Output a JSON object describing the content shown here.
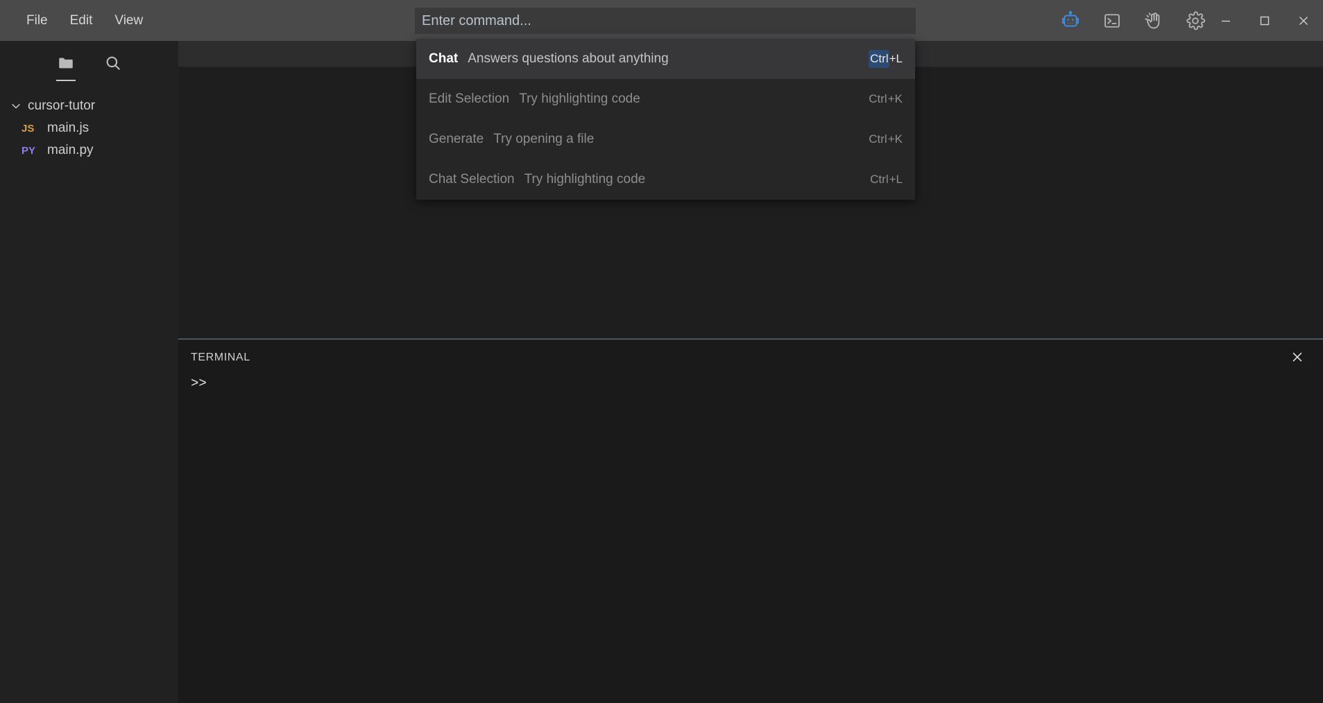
{
  "window": {
    "menu": [
      {
        "label": "File",
        "name": "menu-file"
      },
      {
        "label": "Edit",
        "name": "menu-edit"
      },
      {
        "label": "View",
        "name": "menu-view"
      }
    ],
    "controls": {
      "minimize": "–",
      "maximize": "□",
      "close": "✕"
    },
    "toolbar_icons": [
      {
        "name": "ai-robot-icon",
        "label": "AI Assistant",
        "color": "#3f8ae0"
      },
      {
        "name": "terminal-icon",
        "label": "Terminal",
        "color": "#b4b4b4"
      },
      {
        "name": "hand-wave-icon",
        "label": "Help",
        "color": "#b4b4b4"
      },
      {
        "name": "gear-icon",
        "label": "Settings",
        "color": "#b4b4b4"
      }
    ]
  },
  "command_bar": {
    "placeholder": "Enter command...",
    "value": ""
  },
  "command_palette": {
    "items": [
      {
        "title": "Chat",
        "description": "Answers questions about anything",
        "shortcut_mod": "Ctrl",
        "shortcut_key": "+L",
        "selected": true
      },
      {
        "title": "Edit Selection",
        "description": "Try highlighting code",
        "shortcut_mod": "Ctrl",
        "shortcut_key": "+K",
        "selected": false
      },
      {
        "title": "Generate",
        "description": "Try opening a file",
        "shortcut_mod": "Ctrl",
        "shortcut_key": "+K",
        "selected": false
      },
      {
        "title": "Chat Selection",
        "description": "Try highlighting code",
        "shortcut_mod": "Ctrl",
        "shortcut_key": "+L",
        "selected": false
      }
    ]
  },
  "sidebar": {
    "icons": [
      {
        "name": "folder-icon",
        "label": "Explorer",
        "active": true
      },
      {
        "name": "search-icon",
        "label": "Search",
        "active": false
      }
    ],
    "tree": {
      "root": {
        "label": "cursor-tutor",
        "expanded": true
      },
      "files": [
        {
          "name": "main.js",
          "badge": "JS",
          "badge_color": "#d3a04a"
        },
        {
          "name": "main.py",
          "badge": "PY",
          "badge_color": "#8b7fe8"
        }
      ]
    }
  },
  "terminal": {
    "title": "TERMINAL",
    "prompt": ">>",
    "close_label": "✕"
  },
  "colors": {
    "titlebar_bg": "#4a4a4a",
    "sidebar_bg": "#212121",
    "editor_bg": "#1e1e1e",
    "terminal_bg": "#1a1a1a",
    "accent_blue": "#3f8ae0",
    "selected_row_bg": "#37373a",
    "key_badge_bg": "#2d4a73"
  }
}
